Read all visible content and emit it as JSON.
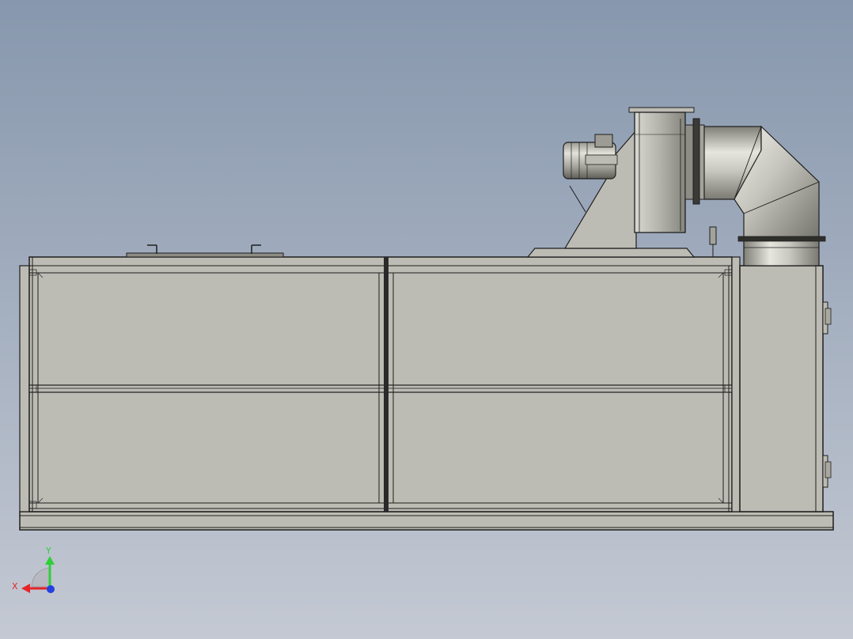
{
  "viewport": {
    "background_top": "#8797ad",
    "background_bottom": "#c4c9d3",
    "model_color": "#bdbcb4"
  },
  "triad": {
    "x_label": "X",
    "y_label": "Y",
    "x_color": "#e5252a",
    "y_color": "#2fcf3a",
    "z_color": "#2340e0"
  },
  "model": {
    "components": [
      "enclosure-body",
      "base-rail",
      "side-cabinet",
      "centrifugal-fan",
      "fan-motor",
      "duct-elbow",
      "top-access-hatch"
    ]
  }
}
